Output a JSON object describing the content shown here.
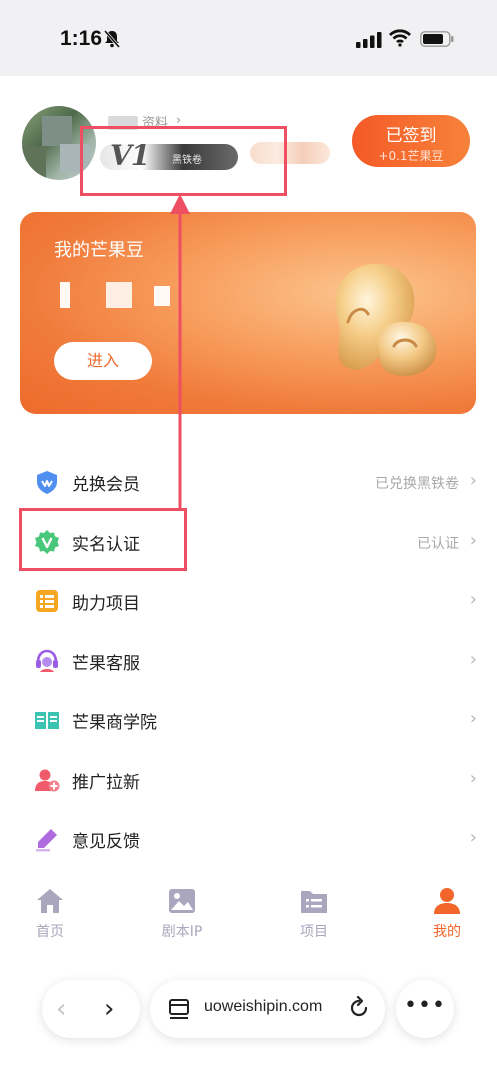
{
  "status_bar": {
    "time": "1:16",
    "icons": [
      "bell-muted-icon",
      "signal-icon",
      "wifi-icon",
      "battery-icon"
    ]
  },
  "profile": {
    "profile_link": "资料",
    "profile_chevron": "›",
    "vip_level": "V1",
    "vip_name": "黑铁卷"
  },
  "checkin": {
    "label": "已签到",
    "reward": "+0.1芒果豆"
  },
  "beans_card": {
    "title": "我的芒果豆",
    "enter_label": "进入"
  },
  "menu": [
    {
      "label": "兑换会员",
      "value": "已兑换黑铁卷",
      "icon": "vip-shield-icon",
      "color": "#4f8ff0"
    },
    {
      "label": "实名认证",
      "value": "已认证",
      "icon": "verified-badge-icon",
      "color": "#49c77a"
    },
    {
      "label": "助力项目",
      "value": "",
      "icon": "list-doc-icon",
      "color": "#f5a623"
    },
    {
      "label": "芒果客服",
      "value": "",
      "icon": "headset-icon",
      "color": "#9b5de5"
    },
    {
      "label": "芒果商学院",
      "value": "",
      "icon": "book-icon",
      "color": "#3cc3b2"
    },
    {
      "label": "推广拉新",
      "value": "",
      "icon": "add-user-icon",
      "color": "#ef5b6b"
    },
    {
      "label": "意见反馈",
      "value": "",
      "icon": "pen-icon",
      "color": "#b06adf"
    }
  ],
  "menu_chevron": "›",
  "tabs": [
    {
      "label": "首页",
      "icon": "home-icon",
      "active": false
    },
    {
      "label": "剧本IP",
      "icon": "image-icon",
      "active": false
    },
    {
      "label": "项目",
      "icon": "folder-list-icon",
      "active": false
    },
    {
      "label": "我的",
      "icon": "person-icon",
      "active": true
    }
  ],
  "browser": {
    "url": "uoweishipin.com",
    "back": "‹",
    "forward": "›",
    "more": "•••"
  },
  "colors": {
    "accent": "#f2662b",
    "annotation": "#ef4f63",
    "inactive_tab": "#a9a6bd"
  }
}
